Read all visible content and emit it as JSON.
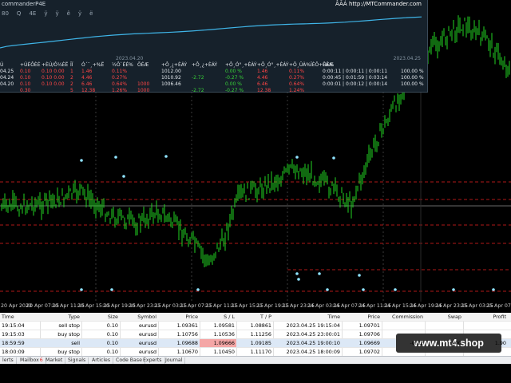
{
  "panel": {
    "title": "commanderP4E",
    "brand": "ÂÃÁ http://MTCommander.com",
    "tabs": [
      "80",
      "Q",
      "4E",
      "ÿ",
      "ÿ",
      "ê",
      "ÿ",
      "ë"
    ],
    "date_left": "2023.04.20",
    "date_right": "2023.04.25",
    "headers": [
      "Ú",
      "+ÚÈÔÈÉ",
      "+ÈÚ/Ô¼ÈË",
      "ÎÏ",
      "Ó´¯¸+%Ë",
      "½Ô`ÈÉ%",
      "ÕÉÆ",
      "+Ô¸¿+ÈÁÝ",
      "+Ô¸¿+ÈÁÝ",
      "+Ô¸Ó°¸+ÈÀÝ",
      "+Ô¸Ó°¸+ÈÁÝ",
      "+Ô¸ÛÀ%ÎÈÔ+ÙÈ%",
      "ÈÁÆ"
    ],
    "rows": [
      [
        "04.25",
        "0.10",
        "0.10 0.00",
        "1",
        "1.46",
        "0.11%",
        "",
        "1012.00",
        "",
        "0.00 %",
        "1.46",
        "0.11%",
        "0:00:11 | 0:00:11 | 0:00:11",
        "100.00 %"
      ],
      [
        "04.24",
        "0.10",
        "0.10 0.00",
        "2",
        "4.46",
        "0.27%",
        "",
        "1010.92",
        "-2.72",
        "-0.27 %",
        "4.46",
        "0.27%",
        "0:00:45 | 0:01:59 | 0:03:14",
        "100.00 %"
      ],
      [
        "04.20",
        "0.10",
        "0.10 0.00",
        "2",
        "6.46",
        "0.64%",
        "1000",
        "1006.46",
        "",
        "0.00 %",
        "6.46",
        "0.64%",
        "0:00:01 | 0:00:12 | 0:00:14",
        "100.00 %"
      ],
      [
        "",
        "0.30",
        "",
        "5",
        "12.38",
        "1.26%",
        "1000",
        "",
        "-2.72",
        "-0.27 %",
        "12.38",
        "1.24%",
        "",
        ""
      ]
    ]
  },
  "time_axis": [
    "20 Apr 2023",
    "20 Apr 07:15",
    "20 Apr 11:15",
    "20 Apr 15:15",
    "20 Apr 19:15",
    "20 Apr 23:15",
    "21 Apr 03:15",
    "21 Apr 07:15",
    "21 Apr 11:15",
    "21 Apr 15:15",
    "21 Apr 19:15",
    "21 Apr 23:15",
    "24 Apr 03:15",
    "24 Apr 07:15",
    "24 Apr 11:15",
    "24 Apr 15:15",
    "24 Apr 19:15",
    "24 Apr 23:15",
    "25 Apr 03:15",
    "25 Apr 07:15"
  ],
  "trades": {
    "columns": [
      "Time",
      "Type",
      "Size",
      "Symbol",
      "Price",
      "S / L",
      "T / P",
      "Time",
      "Price",
      "Commission",
      "Swap",
      "Profit"
    ],
    "rows": [
      [
        "19:15:04",
        "sell stop",
        "0.10",
        "eurusd",
        "1.09361",
        "1.09581",
        "1.08861",
        "2023.04.25 19:15:04",
        "1.09701",
        "",
        "",
        ""
      ],
      [
        "19:15:03",
        "buy stop",
        "0.10",
        "eurusd",
        "1.10756",
        "1.10536",
        "1.11256",
        "2023.04.25 23:00:01",
        "1.09706",
        "",
        "",
        ""
      ],
      [
        "18:59:59",
        "sell",
        "0.10",
        "eurusd",
        "1.09688",
        "1.09666",
        "1.09185",
        "2023.04.25 19:00:10",
        "1.09669",
        "-0.22",
        "0.00",
        "1.90"
      ],
      [
        "18:00:09",
        "buy stop",
        "0.10",
        "eurusd",
        "1.10670",
        "1.10450",
        "1.11170",
        "2023.04.25 18:00:09",
        "1.09702",
        "",
        "",
        ""
      ]
    ]
  },
  "tabs": [
    "lerts",
    "Mailbox",
    "Market",
    "Signals",
    "Articles",
    "Code Base",
    "Experts",
    "Journal"
  ],
  "mailbox_badge": "6",
  "watermark": "www.mt4.shop",
  "colors": {
    "candle": "#22d422",
    "equity": "#3fb5e8",
    "dot": "#8fe3ff",
    "level": "#b01919"
  }
}
